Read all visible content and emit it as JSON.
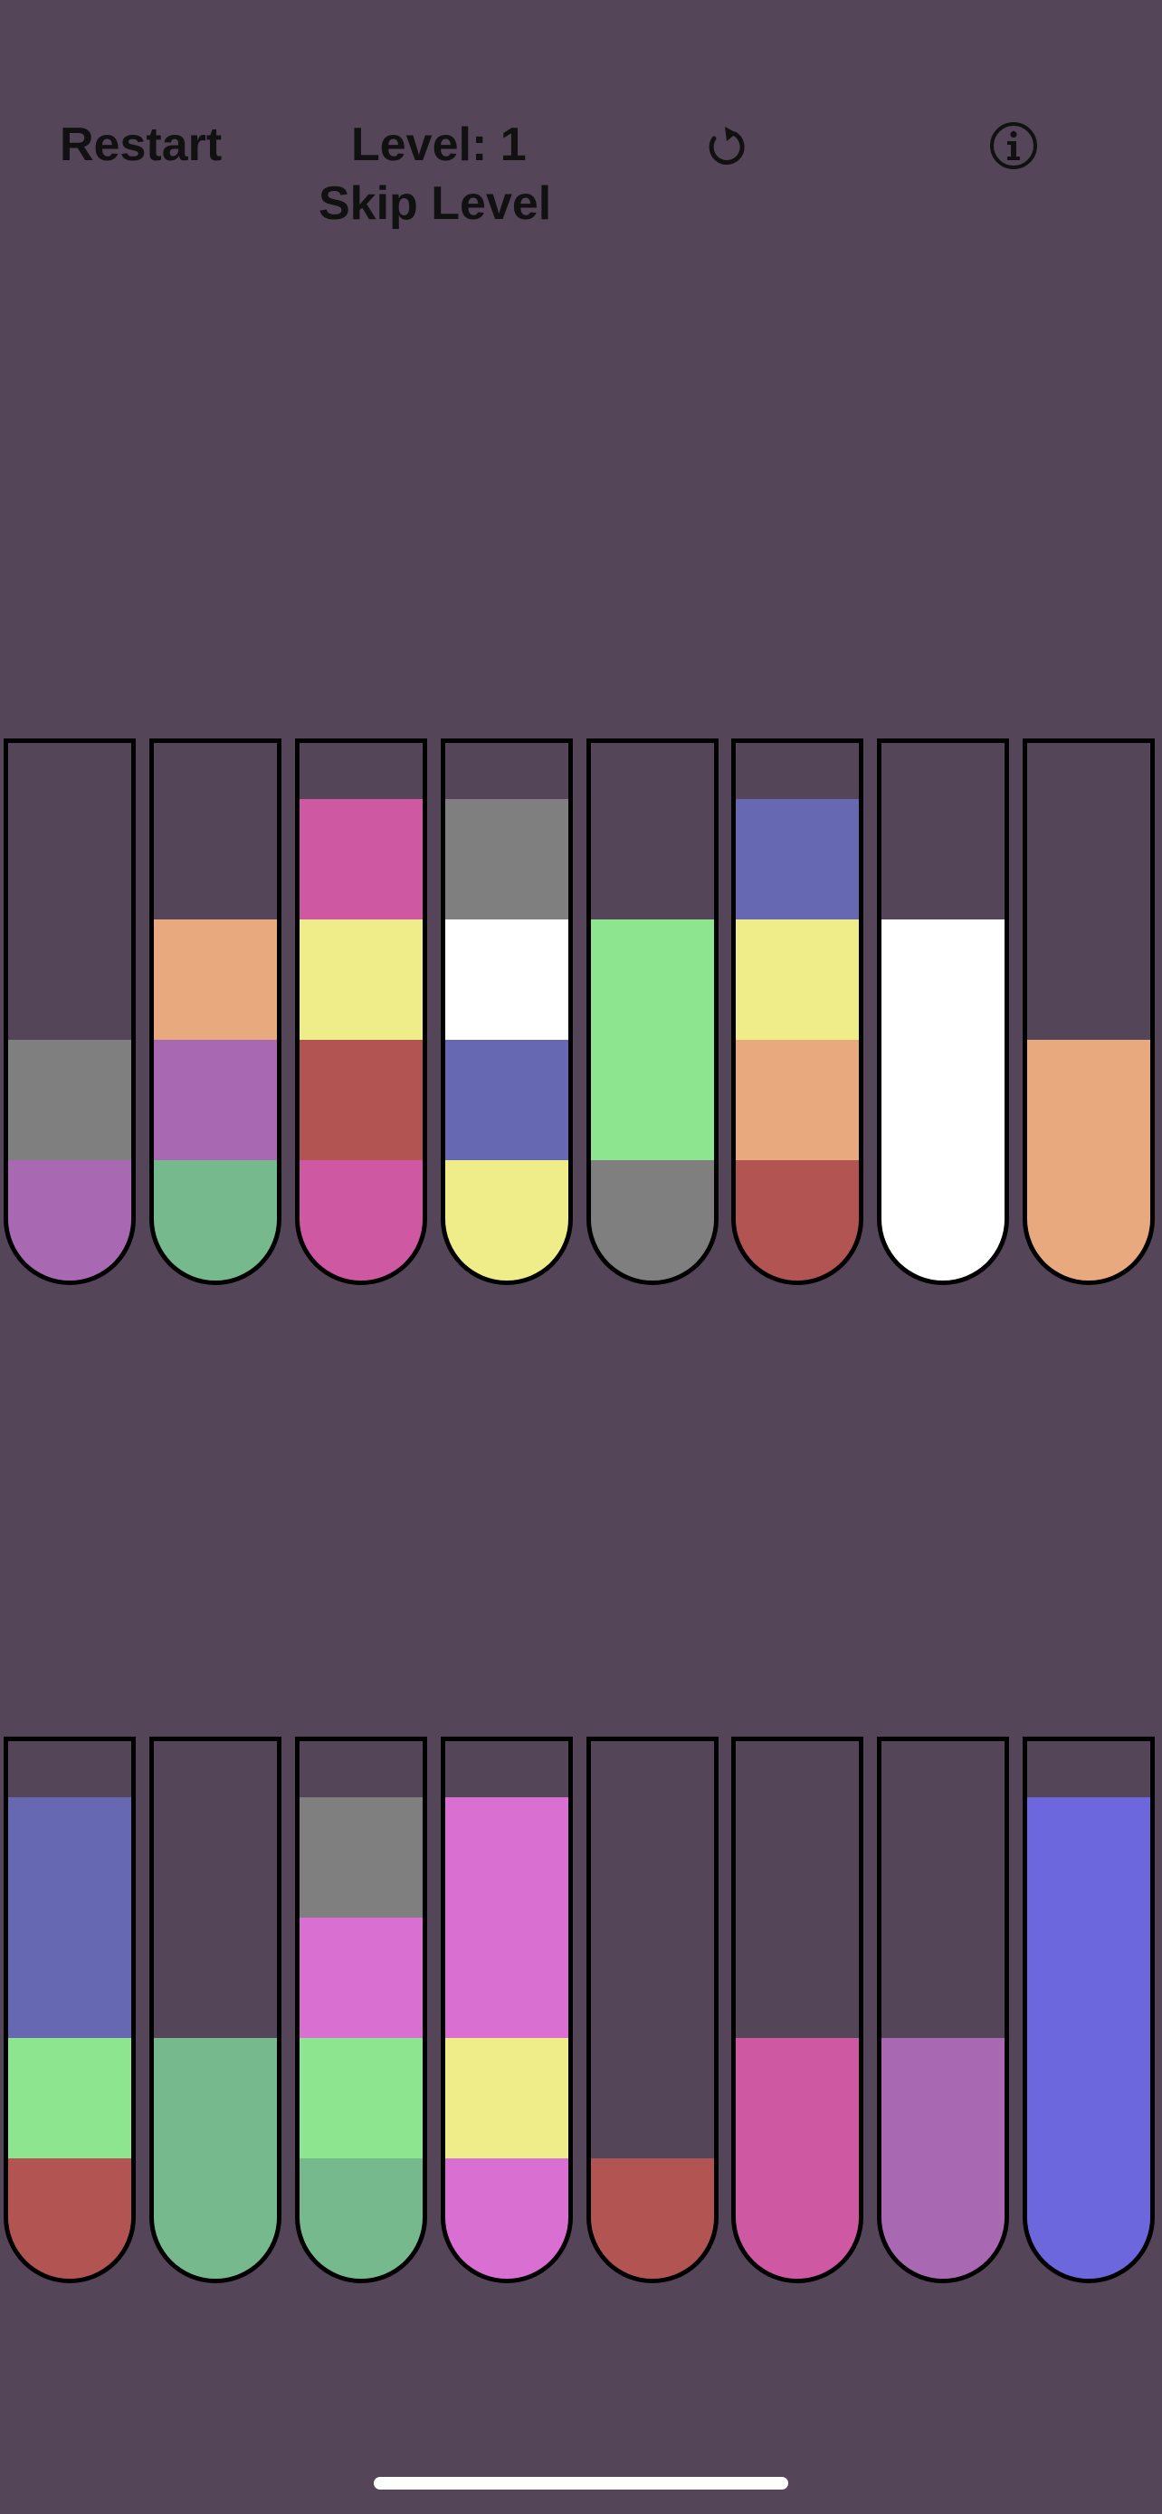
{
  "header": {
    "restart_label": "Restart",
    "level_label": "Level: 1",
    "skip_label": "Skip Level",
    "reset_icon": "reset-icon",
    "info_icon": "info-icon"
  },
  "colors": {
    "background": "#554558",
    "gray": "#7f7f7f",
    "purple": "#a869b2",
    "peach": "#e8a97f",
    "green": "#75b98d",
    "pink": "#ce58a1",
    "yellow": "#eeed89",
    "red": "#b15452",
    "white": "#ffffff",
    "slate_blue": "#6668b2",
    "light_green": "#8ee590",
    "orchid": "#d96fd0",
    "indigo": "#6d67de"
  },
  "tubes_row1": [
    [
      "purple",
      "gray"
    ],
    [
      "green",
      "purple",
      "peach"
    ],
    [
      "pink",
      "red",
      "yellow",
      "pink"
    ],
    [
      "yellow",
      "slate_blue",
      "white",
      "gray"
    ],
    [
      "gray",
      "light_green",
      "light_green"
    ],
    [
      "red",
      "peach",
      "yellow",
      "slate_blue"
    ],
    [
      "white",
      "white",
      "white"
    ],
    [
      "peach",
      "peach"
    ]
  ],
  "tubes_row2": [
    [
      "red",
      "light_green",
      "slate_blue",
      "slate_blue"
    ],
    [
      "green",
      "green"
    ],
    [
      "green",
      "light_green",
      "orchid",
      "gray"
    ],
    [
      "orchid",
      "yellow",
      "orchid",
      "orchid"
    ],
    [
      "red"
    ],
    [
      "pink",
      "pink"
    ],
    [
      "purple",
      "purple"
    ],
    [
      "indigo",
      "indigo",
      "indigo",
      "indigo"
    ]
  ]
}
